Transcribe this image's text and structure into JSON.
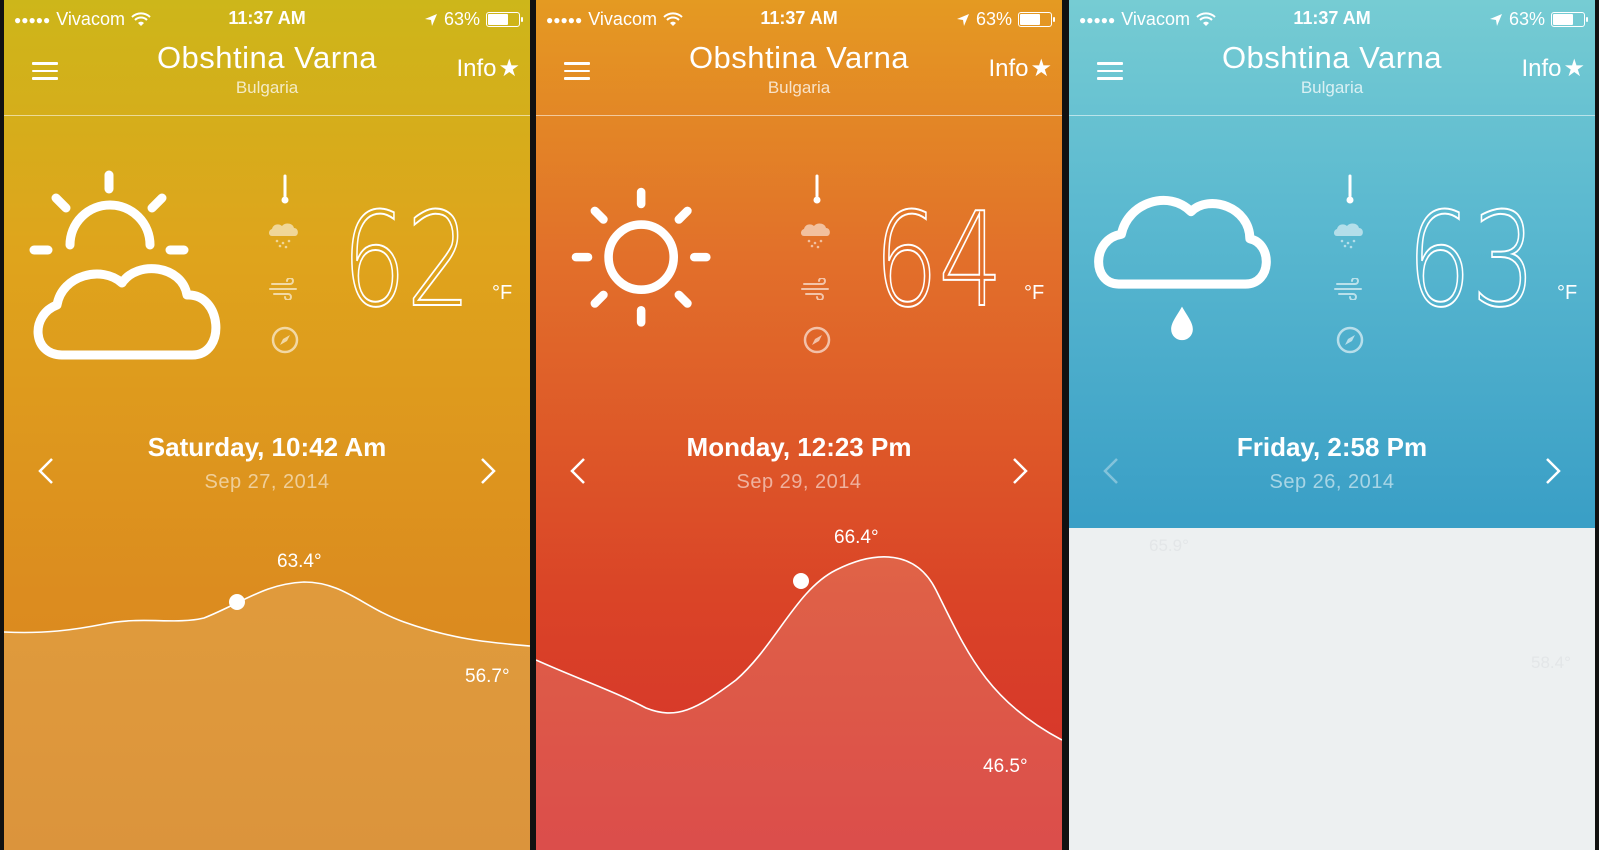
{
  "status_bar": {
    "signal": "●●●●●",
    "carrier": "Vivacom",
    "time": "11:37 AM",
    "battery": "63%",
    "battery_level": 0.63
  },
  "nav": {
    "city": "Obshtina Varna",
    "country": "Bulgaria",
    "info_label": "Info",
    "info_star": "★"
  },
  "screens": [
    {
      "icon": "partly-cloudy-icon",
      "temperature": "62",
      "unit": "°F",
      "day_time": "Saturday, 10:42 Am",
      "date": "Sep 27, 2014",
      "high_label": "63.4°",
      "low_label": "56.7°",
      "colors": {
        "top": "#cdb61a",
        "bottom": "#d68520"
      }
    },
    {
      "icon": "sun-icon",
      "temperature": "64",
      "unit": "°F",
      "day_time": "Monday, 12:23 Pm",
      "date": "Sep 29, 2014",
      "high_label": "66.4°",
      "low_label": "46.5°",
      "colors": {
        "top": "#e49a22",
        "bottom": "#d52f2c"
      }
    },
    {
      "icon": "rain-cloud-icon",
      "temperature": "63",
      "unit": "°F",
      "day_time": "Friday, 2:58 Pm",
      "date": "Sep 26, 2014",
      "ghost_high_label": "65.9°",
      "ghost_low_label": "58.4°",
      "colors": {
        "top": "#76ccd3",
        "bottom": "#3a9fc6",
        "panel": "#edf0f1"
      }
    }
  ],
  "detail_icons": [
    "thermometer-icon",
    "rain-icon",
    "wind-icon",
    "compass-icon"
  ]
}
